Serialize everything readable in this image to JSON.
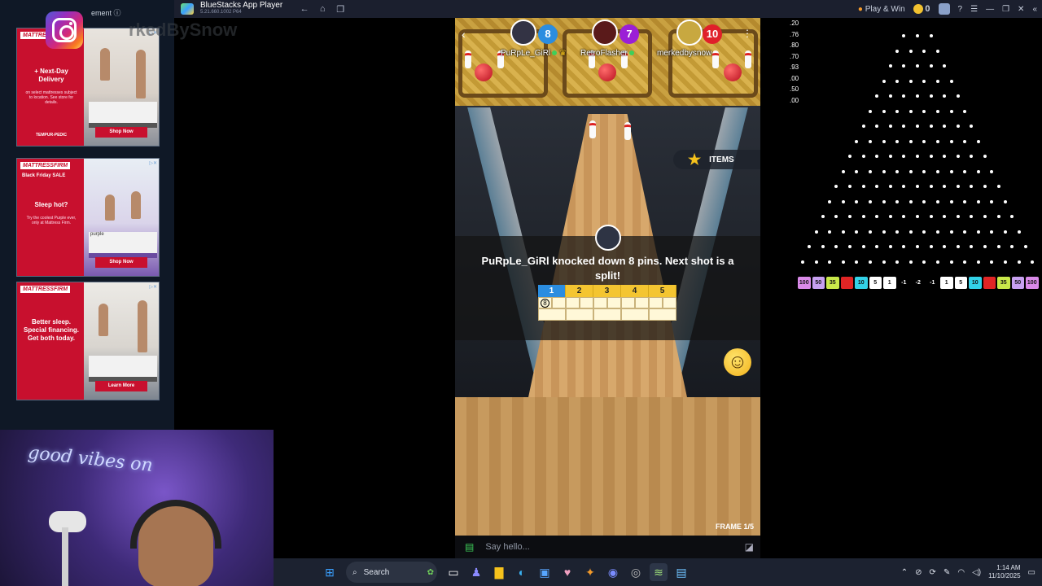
{
  "window": {
    "app_name": "BlueStacks App Player",
    "version": "5.21.660.1002 P64",
    "play_win": "Play & Win",
    "coin_count": "0"
  },
  "ads": [
    {
      "brand": "MATTRESSFIRM",
      "sub": "",
      "headline": "+ Next-Day Delivery",
      "fine": "on select mattresses subject to location. See store for details.",
      "logo": "TEMPUR-PEDIC",
      "cta": "Shop Now"
    },
    {
      "brand": "MATTRESSFIRM",
      "sub": "Black Friday SALE",
      "headline": "Sleep hot?",
      "fine": "Try the coolest Purple ever, only at Mattress Firm.",
      "logo": "purple",
      "cta": "Shop Now"
    },
    {
      "brand": "MATTRESSFIRM",
      "sub": "",
      "headline": "Better sleep. Special financing. Get both today.",
      "fine": "",
      "logo": "",
      "cta": "Learn More"
    }
  ],
  "ad_label": "ement ⓘ",
  "handle_overlay": "rkedBySnow",
  "webcam": {
    "neon_text": "good vibes on"
  },
  "game": {
    "players": [
      {
        "name": "PuRpLe_GiRl",
        "score": "8",
        "color": "#2b8de0"
      },
      {
        "name": "RetroFlasher",
        "score": "7",
        "color": "#9b1fd6"
      },
      {
        "name": "merkedbysnow",
        "score": "10",
        "color": "#e0202a"
      }
    ],
    "items_label": "ITEMS",
    "message": "PuRpLe_GiRl knocked down 8 pins. Next shot is a split!",
    "scorecard": {
      "frames": [
        "1",
        "2",
        "3",
        "4",
        "5"
      ],
      "active_frame": 0,
      "first_roll": "8"
    },
    "frame_label": "FRAME 1/5"
  },
  "chat": {
    "placeholder": "Say hello..."
  },
  "plinko": {
    "odds": [
      ".20",
      ".76",
      ".80",
      ".70",
      ".93",
      ".00",
      ".50",
      ".00"
    ],
    "slots": [
      {
        "label": "100",
        "color": "#d98ae8"
      },
      {
        "label": "50",
        "color": "#c7a0f0"
      },
      {
        "label": "35",
        "color": "#c9e84a"
      },
      {
        "label": "",
        "color": "#e02525"
      },
      {
        "label": "10",
        "color": "#33d2e8"
      },
      {
        "label": "5",
        "color": "#ffffff"
      },
      {
        "label": "1",
        "color": "#ffffff"
      },
      {
        "label": "-1",
        "color": "transparent"
      },
      {
        "label": "-2",
        "color": "transparent"
      },
      {
        "label": "-1",
        "color": "transparent"
      },
      {
        "label": "1",
        "color": "#ffffff"
      },
      {
        "label": "5",
        "color": "#ffffff"
      },
      {
        "label": "10",
        "color": "#33d2e8"
      },
      {
        "label": "",
        "color": "#e02525"
      },
      {
        "label": "35",
        "color": "#c9e84a"
      },
      {
        "label": "50",
        "color": "#c7a0f0"
      },
      {
        "label": "100",
        "color": "#d98ae8"
      }
    ]
  },
  "taskbar": {
    "search_label": "Search",
    "time": "1:14 AM",
    "date": "11/10/2025"
  }
}
